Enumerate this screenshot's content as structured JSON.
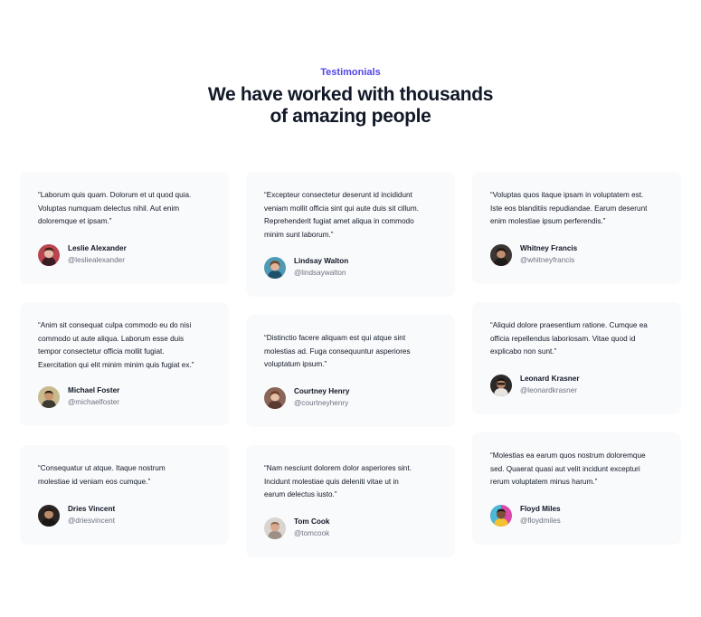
{
  "header": {
    "eyebrow": "Testimonials",
    "title_line1": "We have worked with thousands",
    "title_line2": "of amazing people"
  },
  "columns": [
    [
      {
        "quote": "“Laborum quis quam. Dolorum et ut quod quia.\nVoluptas numquam delectus nihil. Aut enim\ndoloremque et ipsam.”",
        "name": "Leslie Alexander",
        "handle": "@lesliealexander",
        "avatar": "avatar-leslie-alexander"
      },
      {
        "quote": "“Anim sit consequat culpa commodo eu do nisi\ncommodo ut aute aliqua. Laborum esse duis\ntempor consectetur officia mollit fugiat.\nExercitation qui elit minim minim quis fugiat ex.”",
        "name": "Michael Foster",
        "handle": "@michaelfoster",
        "avatar": "avatar-michael-foster"
      },
      {
        "quote": "“Consequatur ut atque. Itaque nostrum\nmolestiae id veniam eos cumque.”",
        "name": "Dries Vincent",
        "handle": "@driesvincent",
        "avatar": "avatar-dries-vincent"
      }
    ],
    [
      {
        "quote": "“Excepteur consectetur deserunt id incididunt\nveniam mollit officia sint qui aute duis sit cillum.\nReprehenderit fugiat amet aliqua in commodo\nminim sunt laborum.”",
        "name": "Lindsay Walton",
        "handle": "@lindsaywalton",
        "avatar": "avatar-lindsay-walton"
      },
      {
        "quote": "“Distinctio facere aliquam est qui atque sint\nmolestias ad. Fuga consequuntur asperiores\nvoluptatum ipsum.”",
        "name": "Courtney Henry",
        "handle": "@courtneyhenry",
        "avatar": "avatar-courtney-henry"
      },
      {
        "quote": "“Nam nesciunt dolorem dolor asperiores sint.\nIncidunt molestiae quis deleniti vitae ut in\nearum delectus iusto.”",
        "name": "Tom Cook",
        "handle": "@tomcook",
        "avatar": "avatar-tom-cook"
      }
    ],
    [
      {
        "quote": "“Voluptas quos itaque ipsam in voluptatem est.\nIste eos blanditiis repudiandae. Earum deserunt\nenim molestiae ipsum perferendis.”",
        "name": "Whitney Francis",
        "handle": "@whitneyfrancis",
        "avatar": "avatar-whitney-francis"
      },
      {
        "quote": "“Aliquid dolore praesentium ratione. Cumque ea\nofficia repellendus laboriosam. Vitae quod id\nexplicabo non sunt.”",
        "name": "Leonard Krasner",
        "handle": "@leonardkrasner",
        "avatar": "avatar-leonard-krasner"
      },
      {
        "quote": "“Molestias ea earum quos nostrum doloremque\nsed. Quaerat quasi aut velit incidunt excepturi\nrerum voluptatem minus harum.”",
        "name": "Floyd Miles",
        "handle": "@floydmiles",
        "avatar": "avatar-floyd-miles"
      }
    ]
  ],
  "colors": {
    "accent": "#4f46e5",
    "card_background": "#f9fafb",
    "heading": "#111827",
    "muted": "#6b7280"
  }
}
